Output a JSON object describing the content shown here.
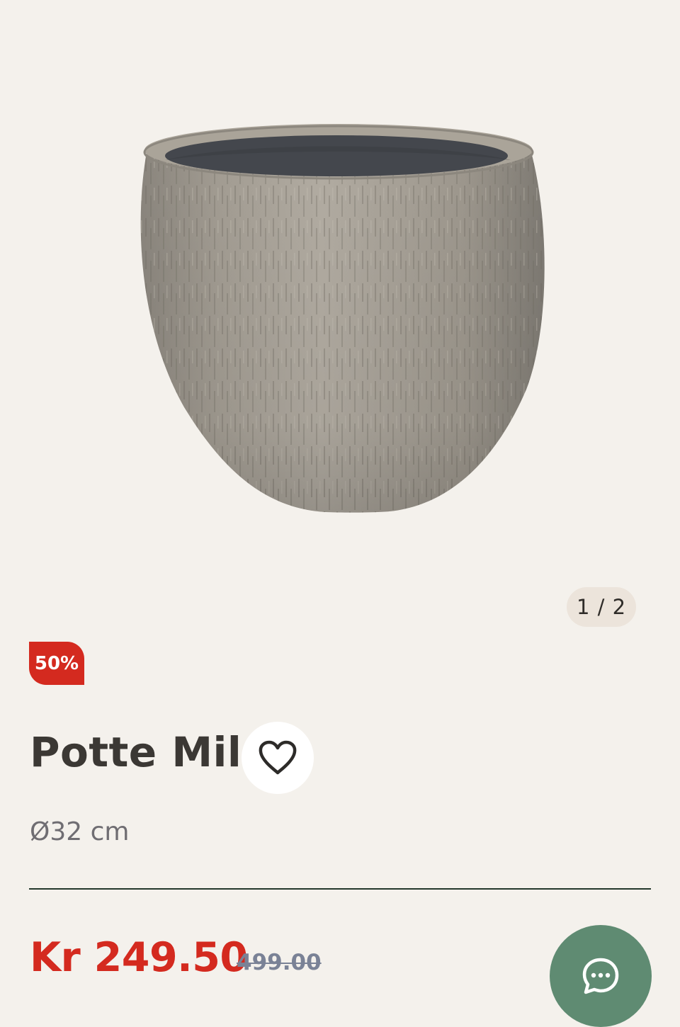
{
  "gallery": {
    "counter": "1 / 2",
    "image_icon": "ceramic-pot-image"
  },
  "product": {
    "discount_badge": "50%",
    "title": "Potte Milo",
    "size": "Ø32 cm",
    "favorite_icon": "heart-outline-icon"
  },
  "pricing": {
    "current_price": "Kr 249.50",
    "original_price": "499.00"
  },
  "chat": {
    "icon": "chat-bubble-icon"
  },
  "colors": {
    "background": "#f4f1ec",
    "sale_red": "#d42a1f",
    "chat_green": "#5f8b72",
    "divider": "#23382c",
    "counter_bg": "#ece4db"
  }
}
